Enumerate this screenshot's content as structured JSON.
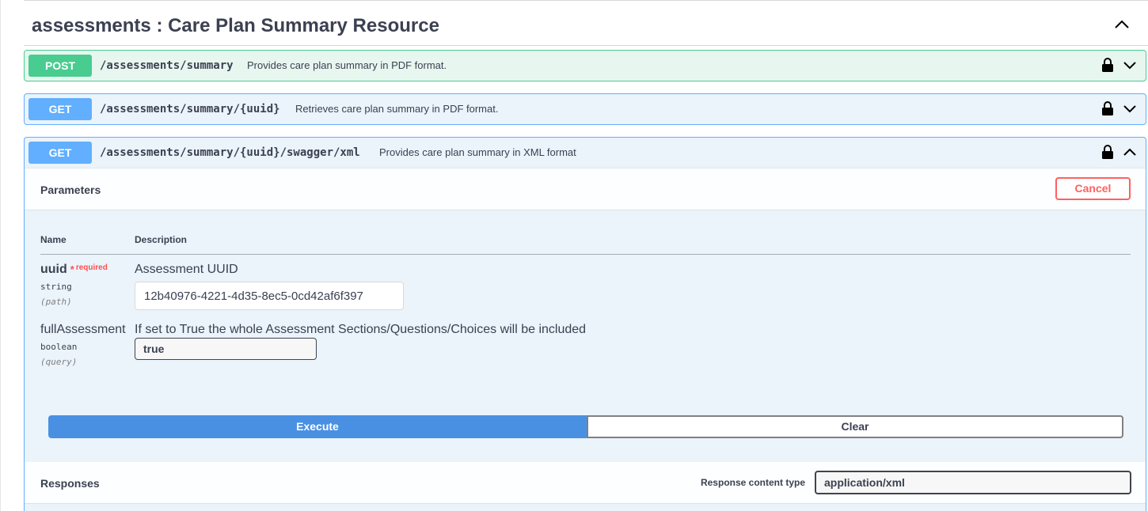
{
  "section": {
    "title": "assessments : Care Plan Summary Resource"
  },
  "operations": [
    {
      "method": "POST",
      "path": "/assessments/summary",
      "description": "Provides care plan summary in PDF format."
    },
    {
      "method": "GET",
      "path": "/assessments/summary/{uuid}",
      "description": "Retrieves care plan summary in PDF format."
    },
    {
      "method": "GET",
      "path": "/assessments/summary/{uuid}/swagger/xml",
      "description": "Provides care plan summary in XML format"
    }
  ],
  "parameters_panel": {
    "title": "Parameters",
    "cancel_label": "Cancel",
    "col_name": "Name",
    "col_description": "Description",
    "params": [
      {
        "name": "uuid",
        "required_star": "*",
        "required_text": "required",
        "type": "string",
        "location": "(path)",
        "description": "Assessment UUID",
        "value": "12b40976-4221-4d35-8ec5-0cd42af6f397"
      },
      {
        "name": "fullAssessment",
        "type": "boolean",
        "location": "(query)",
        "description": "If set to True the whole Assessment Sections/Questions/Choices will be included",
        "value": "true"
      }
    ]
  },
  "actions": {
    "execute_label": "Execute",
    "clear_label": "Clear"
  },
  "responses": {
    "title": "Responses",
    "content_type_label": "Response content type",
    "content_type_value": "application/xml"
  },
  "colors": {
    "post": "#49cc90",
    "get": "#61affe",
    "execute": "#4990e2",
    "cancel": "#ff6060"
  },
  "icons": {
    "lock": "lock-icon",
    "expand": "chevron-down-icon",
    "collapse": "chevron-up-icon"
  }
}
